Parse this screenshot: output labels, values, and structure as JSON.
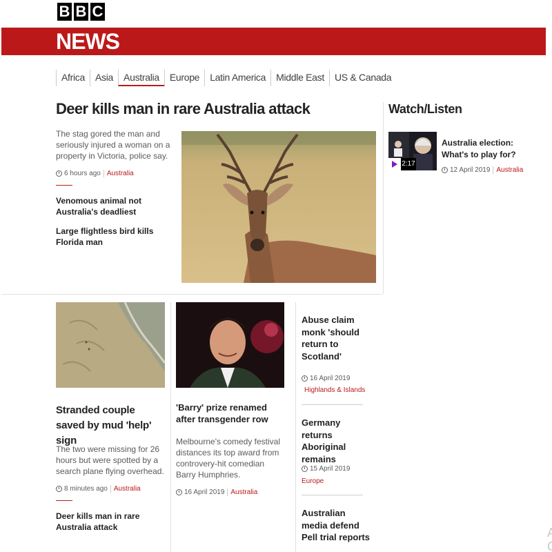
{
  "brand": {
    "letters": [
      "B",
      "B",
      "C"
    ],
    "section": "NEWS",
    "color_red": "#bb1919"
  },
  "nav": [
    {
      "label": "Africa"
    },
    {
      "label": "Asia"
    },
    {
      "label": "Australia",
      "active": true
    },
    {
      "label": "Europe"
    },
    {
      "label": "Latin America"
    },
    {
      "label": "Middle East"
    },
    {
      "label": "US & Canada"
    }
  ],
  "hero": {
    "title": "Deer kills man in rare Australia attack",
    "summary": "The stag gored the man and seriously injured a woman on a property in Victoria, police say.",
    "time": "6 hours ago",
    "tag": "Australia",
    "related": [
      "Venomous animal not Australia's deadliest",
      "Large flightless bird kills Florida man"
    ]
  },
  "watch_listen": {
    "title": "Watch/Listen",
    "item": {
      "duration": "2:17",
      "headline": "Australia election: What's to play for?",
      "date": "12 April 2019",
      "tag": "Australia"
    }
  },
  "stories": {
    "mud": {
      "title": "Stranded couple saved by mud 'help' sign",
      "summary": "The two were missing for 26 hours but were spotted by a search plane flying overhead.",
      "time": "8 minutes ago",
      "tag": "Australia",
      "related": "Deer kills man in rare Australia attack"
    },
    "barry": {
      "title": "'Barry' prize renamed after transgender row",
      "summary": "Melbourne's comedy festival distances its top award from controvery-hit comedian Barry Humphries.",
      "date": "16 April 2019",
      "tag": "Australia"
    },
    "side": [
      {
        "title": "Abuse claim monk 'should return to Scotland'",
        "date": "16 April 2019",
        "tag": "Highlands & Islands"
      },
      {
        "title": "Germany returns Aboriginal remains",
        "date": "15 April 2019",
        "tag": "Europe"
      },
      {
        "title": "Australian media defend Pell trial reports"
      }
    ]
  },
  "scroll_hint": "A\nG"
}
